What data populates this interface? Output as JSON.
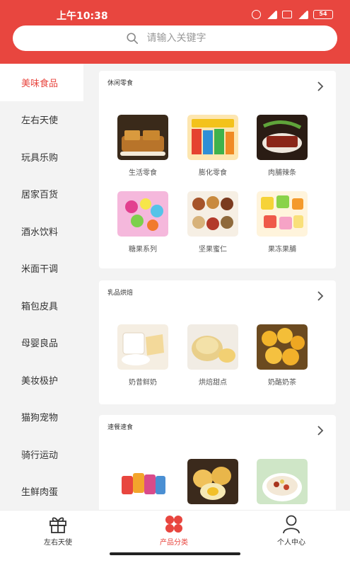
{
  "status": {
    "time": "上午10:38",
    "battery": "54"
  },
  "search": {
    "placeholder": "请输入关键字"
  },
  "sidebar": {
    "items": [
      {
        "label": "美味食品"
      },
      {
        "label": "左右天使"
      },
      {
        "label": "玩具乐购"
      },
      {
        "label": "居家百货"
      },
      {
        "label": "酒水饮料"
      },
      {
        "label": "米面干调"
      },
      {
        "label": "箱包皮具"
      },
      {
        "label": "母婴良品"
      },
      {
        "label": "美妆极护"
      },
      {
        "label": "猫狗宠物"
      },
      {
        "label": "骑行运动"
      },
      {
        "label": "生鲜肉蛋"
      }
    ],
    "active_index": 0
  },
  "sections": [
    {
      "title": "休闲零食",
      "items": [
        {
          "label": "生活零食"
        },
        {
          "label": "膨化零食"
        },
        {
          "label": "肉脯辣条"
        },
        {
          "label": "糖果系列"
        },
        {
          "label": "坚果蜜仁"
        },
        {
          "label": "果冻果脯"
        }
      ]
    },
    {
      "title": "乳品烘焙",
      "items": [
        {
          "label": "奶昔鲜奶"
        },
        {
          "label": "烘焙甜点"
        },
        {
          "label": "奶酪奶茶"
        }
      ]
    },
    {
      "title": "速餐速食",
      "items": [
        {
          "label": ""
        },
        {
          "label": ""
        },
        {
          "label": ""
        }
      ]
    }
  ],
  "bottom_nav": {
    "tabs": [
      {
        "label": "左右天使",
        "icon": "gift-icon"
      },
      {
        "label": "产品分类",
        "icon": "category-icon"
      },
      {
        "label": "个人中心",
        "icon": "user-icon"
      }
    ],
    "active_index": 1
  },
  "colors": {
    "accent": "#e8463f",
    "background": "#f3f3f3"
  }
}
